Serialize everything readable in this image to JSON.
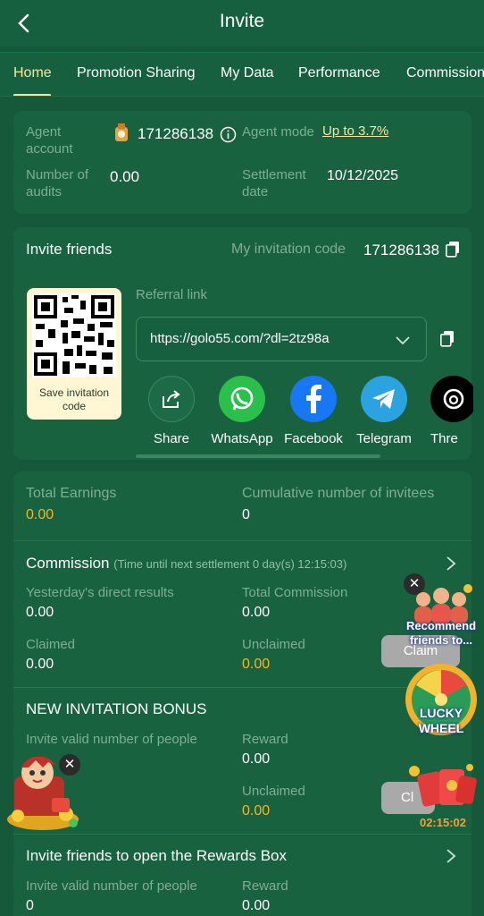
{
  "header": {
    "title": "Invite"
  },
  "tabs": [
    {
      "label": "Home"
    },
    {
      "label": "Promotion Sharing"
    },
    {
      "label": "My Data"
    },
    {
      "label": "Performance"
    },
    {
      "label": "Commission"
    }
  ],
  "agent": {
    "account_label": "Agent account",
    "account_value": "171286138",
    "mode_label": "Agent mode",
    "mode_value": "Up to 3.7%",
    "audits_label": "Number of audits",
    "audits_value": "0.00",
    "settlement_label": "Settlement date",
    "settlement_value": "10/12/2025"
  },
  "invite": {
    "title": "Invite friends",
    "code_label": "My invitation code",
    "code_value": "171286138",
    "save_code_label": "Save invitation code",
    "referral_label": "Referral link",
    "referral_link": "https://golo55.com/?dl=2tz98a",
    "share_items": [
      {
        "label": "Share",
        "icon": "share-icon"
      },
      {
        "label": "WhatsApp",
        "icon": "whatsapp-icon"
      },
      {
        "label": "Facebook",
        "icon": "facebook-icon"
      },
      {
        "label": "Telegram",
        "icon": "telegram-icon"
      },
      {
        "label": "Thre",
        "icon": "threads-icon"
      }
    ]
  },
  "earnings": {
    "total_label": "Total Earnings",
    "total_value": "0.00",
    "cumulative_label": "Cumulative number of invitees",
    "cumulative_value": "0"
  },
  "commission": {
    "title": "Commission",
    "note": "(Time until next settlement 0 day(s) 12:15:03)",
    "yesterday_label": "Yesterday's direct results",
    "yesterday_value": "0.00",
    "total_label": "Total Commission",
    "total_value": "0.00",
    "claimed_label": "Claimed",
    "claimed_value": "0.00",
    "unclaimed_label": "Unclaimed",
    "unclaimed_value": "0.00",
    "claim_button": "Claim"
  },
  "bonus": {
    "title": "NEW INVITATION BONUS",
    "people_label": "Invite valid number of people",
    "reward_label": "Reward",
    "reward_value": "0.00",
    "unclaimed_label": "Unclaimed",
    "unclaimed_value": "0.00",
    "claim_button": "Cl"
  },
  "rewards_box": {
    "title": "Invite friends to open the Rewards Box",
    "people_label": "Invite valid number of people",
    "people_value": "0",
    "reward_label": "Reward",
    "reward_value": "0.00"
  },
  "floating": {
    "recommend_label": "Recommend friends to...",
    "wheel_label_1": "LUCKY",
    "wheel_label_2": "WHEEL",
    "timer": "02:15:02"
  },
  "colors": {
    "background": "#15583a",
    "card": "#186240",
    "accent_gold": "#f6e6a1",
    "value_gold": "#f2b627",
    "whatsapp": "#2bbf4c",
    "facebook": "#1877f2",
    "telegram": "#2aa3e0"
  }
}
